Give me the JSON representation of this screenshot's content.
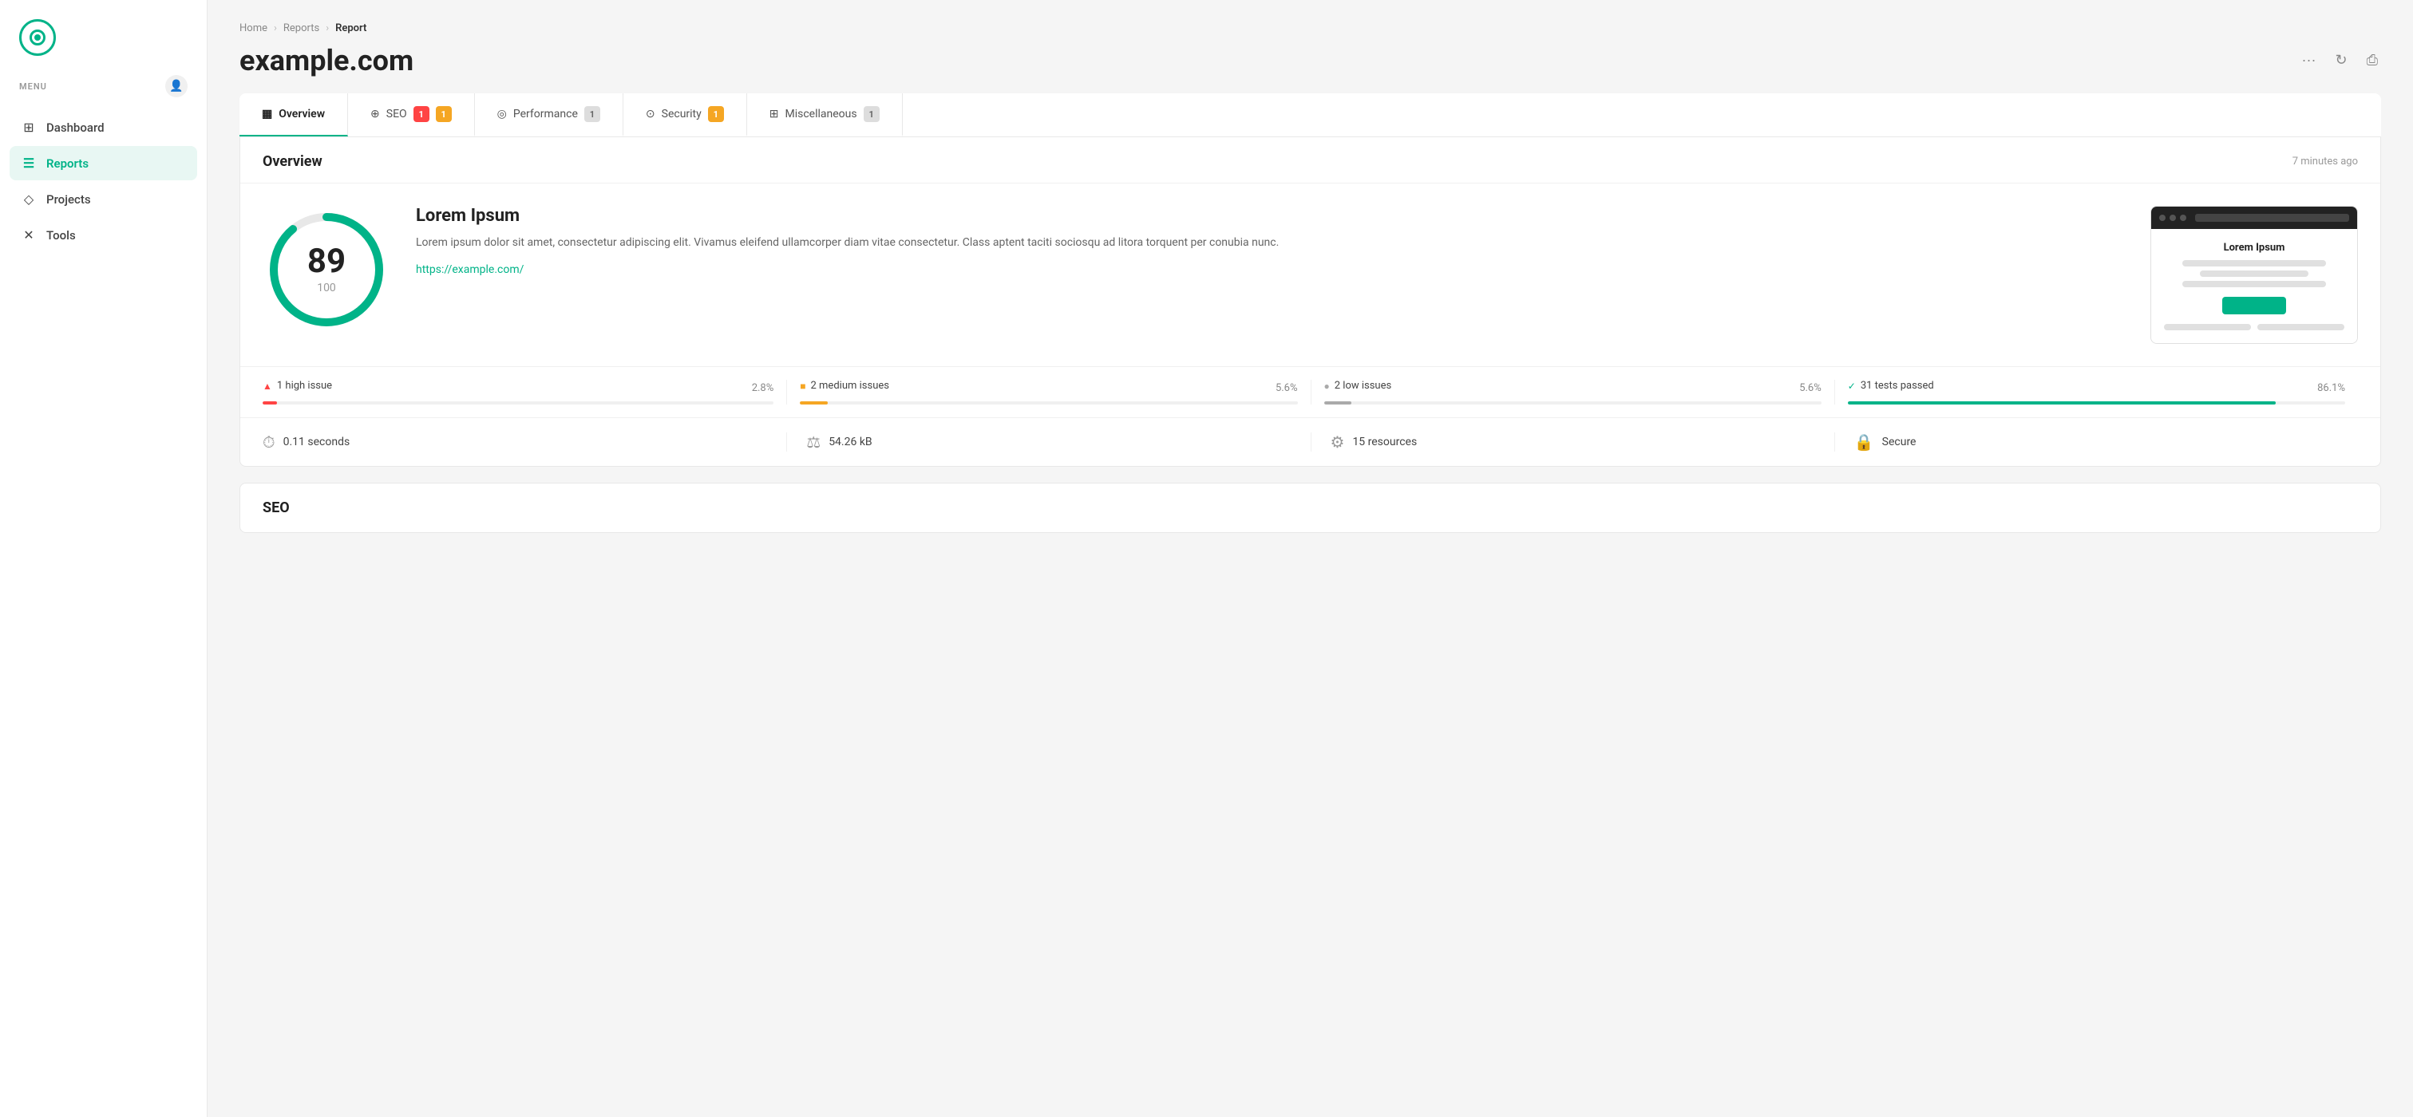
{
  "sidebar": {
    "menu_label": "MENU",
    "nav_items": [
      {
        "id": "dashboard",
        "label": "Dashboard",
        "icon": "⊞",
        "active": false
      },
      {
        "id": "reports",
        "label": "Reports",
        "icon": "≡",
        "active": true
      },
      {
        "id": "projects",
        "label": "Projects",
        "icon": "◇",
        "active": false
      },
      {
        "id": "tools",
        "label": "Tools",
        "icon": "✕",
        "active": false
      }
    ]
  },
  "breadcrumb": {
    "home": "Home",
    "reports": "Reports",
    "current": "Report"
  },
  "page": {
    "title": "example.com"
  },
  "header_actions": {
    "more": "···",
    "refresh": "↻",
    "print": "⎙"
  },
  "tabs": [
    {
      "id": "overview",
      "label": "Overview",
      "icon": "▦",
      "badge": null,
      "active": true
    },
    {
      "id": "seo",
      "label": "SEO",
      "icon": "⊕",
      "badge": [
        {
          "value": "1",
          "type": "red"
        },
        {
          "value": "1",
          "type": "yellow"
        }
      ],
      "active": false
    },
    {
      "id": "performance",
      "label": "Performance",
      "icon": "◎",
      "badge": [
        {
          "value": "1",
          "type": "gray"
        }
      ],
      "active": false
    },
    {
      "id": "security",
      "label": "Security",
      "icon": "⊙",
      "badge": [
        {
          "value": "1",
          "type": "yellow"
        }
      ],
      "active": false
    },
    {
      "id": "miscellaneous",
      "label": "Miscellaneous",
      "icon": "⊞",
      "badge": [
        {
          "value": "1",
          "type": "gray"
        }
      ],
      "active": false
    }
  ],
  "overview": {
    "title": "Overview",
    "time_ago": "7 minutes ago",
    "score": {
      "value": 89,
      "max": 100,
      "percent": 89
    },
    "site_name": "Lorem Ipsum",
    "description": "Lorem ipsum dolor sit amet, consectetur adipiscing elit. Vivamus eleifend ullamcorper diam vitae consectetur. Class aptent taciti sociosqu ad litora torquent per conubia nunc.",
    "url": "https://example.com/",
    "preview": {
      "title": "Lorem Ipsum"
    },
    "issues": [
      {
        "label": "1 high issue",
        "pct": "2.8%",
        "color": "#ff4444",
        "fill_pct": 2.8,
        "icon_type": "red"
      },
      {
        "label": "2 medium issues",
        "pct": "5.6%",
        "color": "#f5a623",
        "fill_pct": 5.6,
        "icon_type": "yellow"
      },
      {
        "label": "2 low issues",
        "pct": "5.6%",
        "color": "#aaa",
        "fill_pct": 5.6,
        "icon_type": "gray"
      },
      {
        "label": "31 tests passed",
        "pct": "86.1%",
        "color": "#00b388",
        "fill_pct": 86.1,
        "icon_type": "green"
      }
    ],
    "stats": [
      {
        "icon": "⏱",
        "value": "0.11 seconds"
      },
      {
        "icon": "⚖",
        "value": "54.26 kB"
      },
      {
        "icon": "⚙",
        "value": "15 resources"
      },
      {
        "icon": "🔒",
        "value": "Secure"
      }
    ]
  },
  "seo_section": {
    "title": "SEO"
  }
}
